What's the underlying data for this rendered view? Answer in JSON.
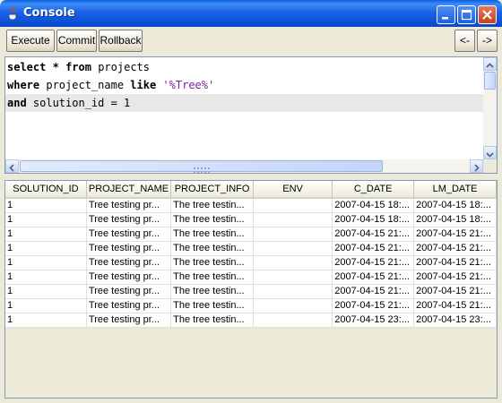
{
  "window": {
    "title": "Console",
    "icon": "java-cup-icon",
    "controls": [
      "minimize-icon",
      "maximize-icon",
      "close-icon"
    ],
    "colors": {
      "titlebar": "#0c52d6",
      "body": "#ece9d8",
      "keyword_string": "#7a1fa0"
    }
  },
  "toolbar": {
    "execute_label": "Execute",
    "commit_label": "Commit",
    "rollback_label": "Rollback",
    "prev_label": "<-",
    "next_label": "->"
  },
  "editor": {
    "lines": [
      [
        {
          "t": "select",
          "k": "kw"
        },
        {
          "t": " "
        },
        {
          "t": "*",
          "k": "kw"
        },
        {
          "t": " "
        },
        {
          "t": "from",
          "k": "kw"
        },
        {
          "t": " projects"
        }
      ],
      [
        {
          "t": "where",
          "k": "kw"
        },
        {
          "t": " project_name "
        },
        {
          "t": "like",
          "k": "kw"
        },
        {
          "t": " "
        },
        {
          "t": "'%Tree%'",
          "k": "str"
        }
      ],
      [
        {
          "t": "and",
          "k": "kw"
        },
        {
          "t": " solution_id = 1"
        }
      ]
    ]
  },
  "results": {
    "columns": [
      "SOLUTION_ID",
      "PROJECT_NAME",
      "PROJECT_INFO",
      "ENV",
      "C_DATE",
      "LM_DATE"
    ],
    "rows": [
      [
        "1",
        "Tree testing pr...",
        "The tree testin...",
        "",
        "2007-04-15 18:...",
        "2007-04-15 18:..."
      ],
      [
        "1",
        "Tree testing pr...",
        "The tree testin...",
        "",
        "2007-04-15 18:...",
        "2007-04-15 18:..."
      ],
      [
        "1",
        "Tree testing pr...",
        "The tree testin...",
        "",
        "2007-04-15 21:...",
        "2007-04-15 21:..."
      ],
      [
        "1",
        "Tree testing pr...",
        "The tree testin...",
        "",
        "2007-04-15 21:...",
        "2007-04-15 21:..."
      ],
      [
        "1",
        "Tree testing pr...",
        "The tree testin...",
        "",
        "2007-04-15 21:...",
        "2007-04-15 21:..."
      ],
      [
        "1",
        "Tree testing pr...",
        "The tree testin...",
        "",
        "2007-04-15 21:...",
        "2007-04-15 21:..."
      ],
      [
        "1",
        "Tree testing pr...",
        "The tree testin...",
        "",
        "2007-04-15 21:...",
        "2007-04-15 21:..."
      ],
      [
        "1",
        "Tree testing pr...",
        "The tree testin...",
        "",
        "2007-04-15 21:...",
        "2007-04-15 21:..."
      ],
      [
        "1",
        "Tree testing pr...",
        "The tree testin...",
        "",
        "2007-04-15 23:...",
        "2007-04-15 23:..."
      ]
    ]
  }
}
